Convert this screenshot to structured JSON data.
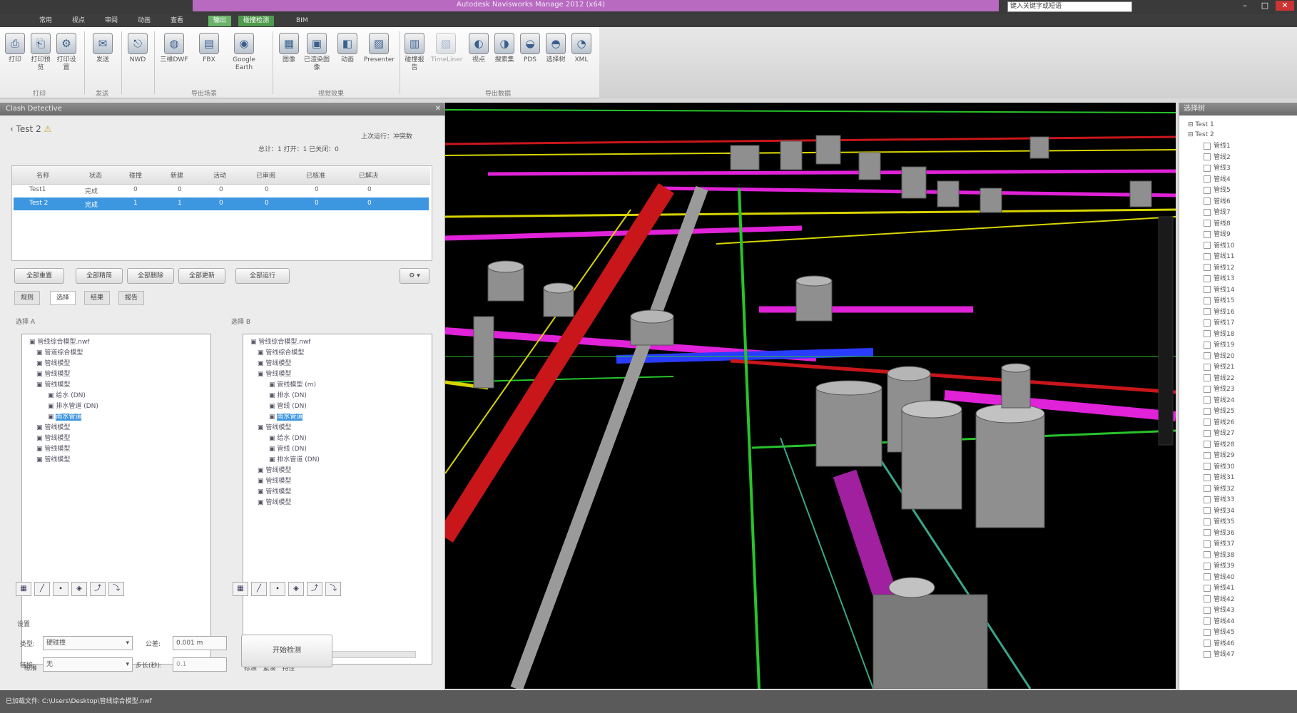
{
  "window": {
    "title": "Autodesk Navisworks Manage 2012 (x64)",
    "search_placeholder": "键入关键字或短语",
    "min": "–",
    "max": "□",
    "close": "✕"
  },
  "ribbon_tabs": [
    "常用",
    "视点",
    "审阅",
    "动画",
    "查看",
    "输出",
    "碰撞检测",
    "BIM"
  ],
  "ribbon": {
    "buttons": [
      {
        "icon": "⎙",
        "label": "打印"
      },
      {
        "icon": "⎗",
        "label": "打印预览"
      },
      {
        "icon": "⚙",
        "label": "打印设置"
      },
      {
        "icon": "✉",
        "label": "发送"
      },
      {
        "icon": "◈",
        "label": "导出场景"
      },
      {
        "icon": "⎋",
        "label": "NWD"
      },
      {
        "icon": "◍",
        "label": "三维DWF"
      },
      {
        "icon": "▤",
        "label": "FBX"
      },
      {
        "icon": "◉",
        "label": "Google Earth"
      },
      {
        "icon": "▦",
        "label": "图像"
      },
      {
        "icon": "▣",
        "label": "已渲染图像"
      },
      {
        "icon": "◧",
        "label": "动画"
      },
      {
        "icon": "▨",
        "label": "Presenter"
      },
      {
        "icon": "▥",
        "label": "碰撞报告"
      },
      {
        "icon": "▧",
        "label": "TimeLiner"
      },
      {
        "icon": "◐",
        "label": "视点"
      },
      {
        "icon": "◑",
        "label": "搜索集"
      },
      {
        "icon": "◒",
        "label": "PDS"
      },
      {
        "icon": "◓",
        "label": "选择树"
      },
      {
        "icon": "◔",
        "label": "XML"
      }
    ],
    "groups": [
      "打印",
      "发送",
      "导出场景",
      "视觉效果",
      "导出数据"
    ]
  },
  "left_panel": {
    "header": "Clash Detective",
    "test_name": "Test 2",
    "status": "上次运行：冲突数",
    "summary": "总计：1   打开：1   已关闭：0",
    "table_headers": [
      "名称",
      "状态",
      "碰撞",
      "新建",
      "活动",
      "已审阅",
      "已核准",
      "已解决"
    ],
    "table_rows": [
      [
        "Test1",
        "完成",
        "0",
        "0",
        "0",
        "0",
        "0",
        "0"
      ],
      [
        "Test 2",
        "完成",
        "1",
        "1",
        "0",
        "0",
        "0",
        "0"
      ]
    ],
    "buttons": [
      "全部重置",
      "全部精简",
      "全部删除",
      "全部更新",
      "全部运行"
    ],
    "subtabs": [
      "规则",
      "选择",
      "结果",
      "报告"
    ],
    "tree_a_label": "选择 A",
    "tree_b_label": "选择 B",
    "tree_a": [
      "管线综合模型.nwf",
      "管道综合模型",
      "管线模型",
      "管线模型",
      "管线模型",
      "给水 (DN)",
      "排水管道 (DN)",
      "雨水管道",
      "管线模型",
      "管线模型",
      "管线模型",
      "管线模型"
    ],
    "tree_b": [
      "管线综合模型.nwf",
      "管线综合模型",
      "管线模型",
      "管线模型",
      "管线模型 (m)",
      "排水 (DN)",
      "管线 (DN)",
      "雨水管道",
      "管线模型",
      "给水 (DN)",
      "管线 (DN)",
      "排水管道 (DN)",
      "管线模型",
      "管线模型",
      "管线模型",
      "管线模型"
    ],
    "tree_tabs": [
      "标准",
      "紧凑",
      "特性"
    ],
    "settings_label": "设置",
    "type_label": "类型:",
    "type_value": "硬碰撞",
    "tolerance_label": "公差:",
    "tolerance_value": "0.001 m",
    "step_label": "链接:",
    "step_value": "无",
    "step2_label": "步长(秒):",
    "step2_value": "0.1",
    "run_button": "开始检测"
  },
  "right_panel": {
    "header": "选择树",
    "root1": "Test 1",
    "root2": "Test 2",
    "items": [
      "管线1",
      "管线2",
      "管线3",
      "管线4",
      "管线5",
      "管线6",
      "管线7",
      "管线8",
      "管线9",
      "管线10",
      "管线11",
      "管线12",
      "管线13",
      "管线14",
      "管线15",
      "管线16",
      "管线17",
      "管线18",
      "管线19",
      "管线20",
      "管线21",
      "管线22",
      "管线23",
      "管线24",
      "管线25",
      "管线26",
      "管线27",
      "管线28",
      "管线29",
      "管线30",
      "管线31",
      "管线32",
      "管线33",
      "管线34",
      "管线35",
      "管线36",
      "管线37",
      "管线38",
      "管线39",
      "管线40",
      "管线41",
      "管线42",
      "管线43",
      "管线44",
      "管线45",
      "管线46",
      "管线47"
    ]
  },
  "status": {
    "text": "已加载文件: C:\\Users\\Desktop\\管线综合模型.nwf"
  },
  "colors": {
    "accent": "#3d96e0",
    "pipe_red": "#c8161b",
    "pipe_magenta": "#e022d8",
    "pipe_green": "#27c42a",
    "pipe_yellow": "#d7d400",
    "pipe_blue": "#2a3cff",
    "pipe_gray": "#9a9a9a"
  }
}
